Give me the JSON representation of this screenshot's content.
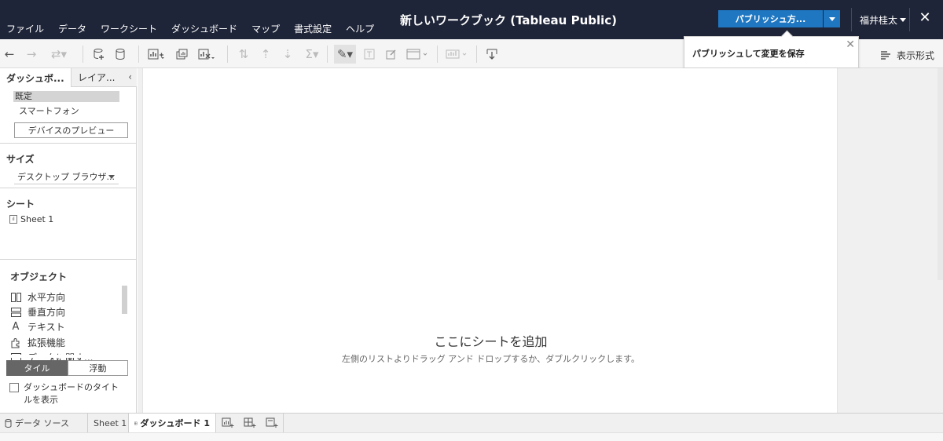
{
  "menu": [
    "ファイル",
    "データ",
    "ワークシート",
    "ダッシュボード",
    "マップ",
    "書式設定",
    "ヘルプ"
  ],
  "window": {
    "title": "新しいワークブック (Tableau Public)"
  },
  "header": {
    "publish_label": "パブリッシュ方...",
    "user_name": "福井桂太"
  },
  "tooltip": {
    "message": "パブリッシュして変更を保存"
  },
  "toolbar": {
    "show_me_label": "表示形式"
  },
  "left_panel": {
    "tab_dashboard": "ダッシュボ...",
    "tab_layout": "レイア...",
    "device_default": "既定",
    "device_phone": "スマートフォン",
    "device_preview_button": "デバイスのプレビュー",
    "size_title": "サイズ",
    "size_value": "デスクトップ ブラウザ...",
    "sheets_title": "シート",
    "sheet_item": "Sheet 1",
    "objects_title": "オブジェクト",
    "objects": [
      "水平方向",
      "垂直方向",
      "テキスト",
      "拡張機能",
      "データに関す..."
    ],
    "tile_label": "タイル",
    "float_label": "浮動",
    "show_title_label": "ダッシュボードのタイトルを表示"
  },
  "canvas": {
    "drop_title": "ここにシートを追加",
    "drop_subtitle": "左側のリストよりドラッグ アンド ドロップするか、ダブルクリックします。"
  },
  "bottom_tabs": {
    "datasource": "データ ソース",
    "sheet1": "Sheet 1",
    "dashboard1": "ダッシュボード 1"
  }
}
